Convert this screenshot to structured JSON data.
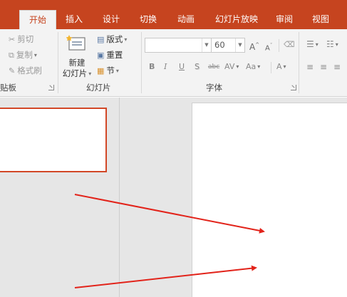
{
  "ribbon_tabs": [
    "开始",
    "插入",
    "设计",
    "切换",
    "动画",
    "幻灯片放映",
    "审阅",
    "视图"
  ],
  "clipboard": {
    "cut": "剪切",
    "copy": "复制",
    "format_painter": "格式刷",
    "label": "贴板"
  },
  "slides_group": {
    "new_slide_line1": "新建",
    "new_slide_line2": "幻灯片",
    "layout": "版式",
    "reset": "重置",
    "section": "节",
    "label": "幻灯片"
  },
  "font_group": {
    "font_name": "",
    "font_size": "60",
    "grow": "A",
    "shrink": "A",
    "bold": "B",
    "italic": "I",
    "underline": "U",
    "shadow": "S",
    "strikethrough": "abc",
    "spacing": "AV",
    "change_case": "Aa",
    "font_color": "A",
    "label": "字体"
  },
  "colors": {
    "accent": "#c6441f",
    "selection_border": "#d24726",
    "arrow": "#e2231a"
  },
  "icons": [
    "scissors-icon",
    "copy-icon",
    "format-painter-icon",
    "new-slide-icon",
    "layout-icon",
    "reset-icon",
    "section-icon",
    "clear-format-icon",
    "bullets-icon",
    "numbering-icon",
    "align-left-icon",
    "align-center-icon",
    "align-right-icon"
  ]
}
